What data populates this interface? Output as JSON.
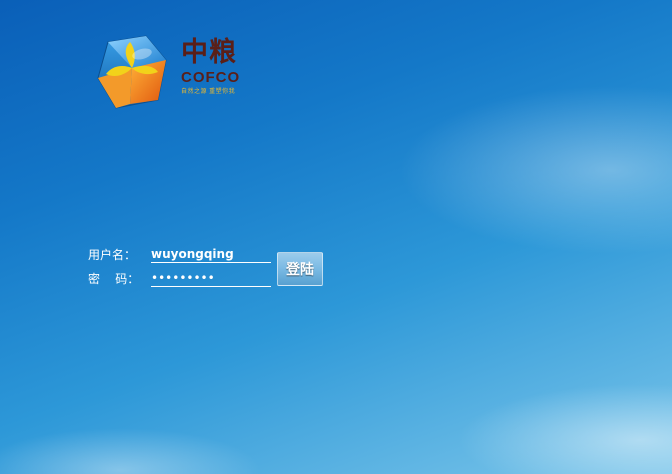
{
  "brand": {
    "name_cn": "中粮",
    "name_en": "COFCO",
    "tagline": "自然之源 重塑你我"
  },
  "login": {
    "username_label": "用户名：",
    "username_value": "wuyongqing",
    "password_label": "密    码：",
    "password_value": "•••••••••",
    "submit_label": "登陆"
  },
  "colors": {
    "sky_top": "#0a5fb8",
    "sky_bottom": "#7cc6ea",
    "brand_text": "#5a1f18",
    "logo_blue": "#2a8fd6",
    "logo_orange": "#f08a1c",
    "logo_yellow": "#f2c21a"
  },
  "icons": {
    "logo": "cofco-cube-logo"
  }
}
